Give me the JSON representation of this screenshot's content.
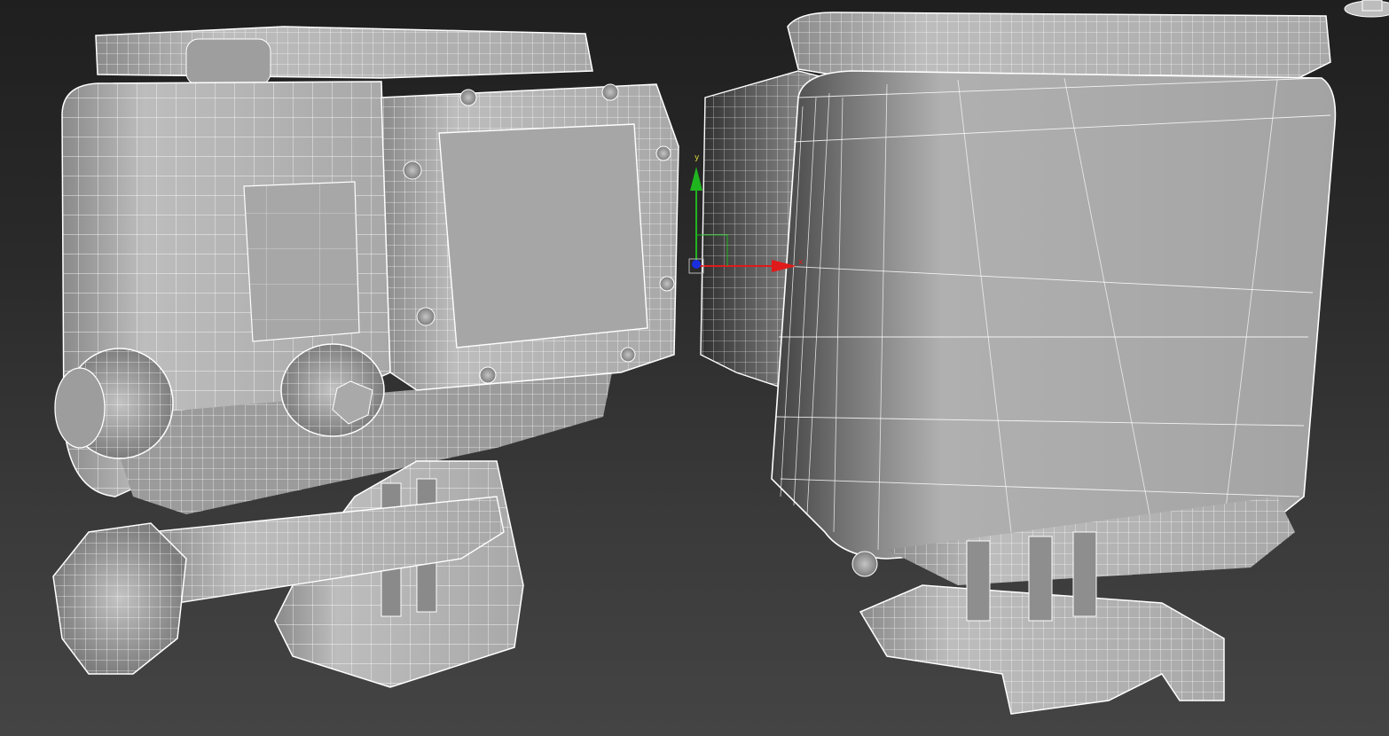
{
  "viewport": {
    "background_top": "#1f1f1f",
    "background_bottom": "#444444",
    "wire_color": "#ffffff",
    "mesh_color": "#b3b3b3",
    "mesh_shadow": "#5a5a5a"
  },
  "objects": [
    {
      "id": "camera-housing-front",
      "view": "perspective-front-left"
    },
    {
      "id": "camera-housing-back",
      "view": "perspective-back-right"
    }
  ],
  "gizmo": {
    "x_label": "x",
    "y_label": "y",
    "x_color": "#e01a1a",
    "y_color": "#1fb51f",
    "z_color": "#1a2ee0"
  },
  "viewcube": {
    "icon": "viewcube-icon"
  }
}
